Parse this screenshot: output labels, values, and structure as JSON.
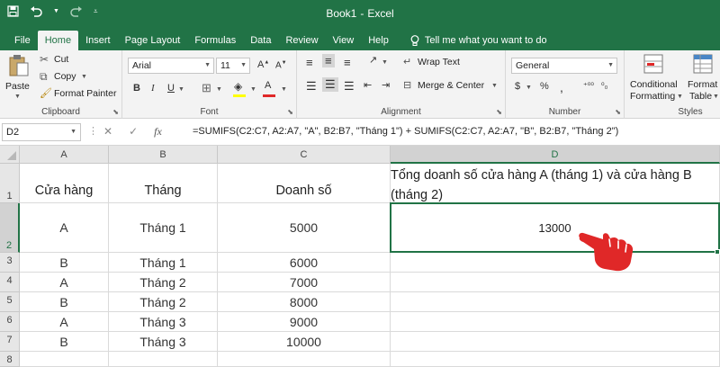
{
  "window": {
    "title": "Book1",
    "separator": "-",
    "app_name": "Excel"
  },
  "tabs": [
    {
      "label": "File",
      "active": false
    },
    {
      "label": "Home",
      "active": true
    },
    {
      "label": "Insert",
      "active": false
    },
    {
      "label": "Page Layout",
      "active": false
    },
    {
      "label": "Formulas",
      "active": false
    },
    {
      "label": "Data",
      "active": false
    },
    {
      "label": "Review",
      "active": false
    },
    {
      "label": "View",
      "active": false
    },
    {
      "label": "Help",
      "active": false
    }
  ],
  "tell_me": "Tell me what you want to do",
  "ribbon": {
    "clipboard": {
      "paste": "Paste",
      "cut": "Cut",
      "copy": "Copy",
      "format_painter": "Format Painter",
      "label": "Clipboard"
    },
    "font": {
      "name": "Arial",
      "size": "11",
      "label": "Font"
    },
    "alignment": {
      "wrap_text": "Wrap Text",
      "merge_center": "Merge & Center",
      "label": "Alignment"
    },
    "number": {
      "format": "General",
      "label": "Number"
    },
    "styles": {
      "conditional": "Conditional",
      "formatting": "Formatting",
      "format_as": "Format a",
      "table": "Table",
      "label": "Styles"
    }
  },
  "formula_bar": {
    "name_box": "D2",
    "formula": "=SUMIFS(C2:C7, A2:A7, \"A\", B2:B7, \"Tháng 1\") + SUMIFS(C2:C7, A2:A7, \"B\", B2:B7, \"Tháng 2\")"
  },
  "sheet": {
    "columns": [
      "A",
      "B",
      "C",
      "D"
    ],
    "rows": [
      "1",
      "2",
      "3",
      "4",
      "5",
      "6",
      "7",
      "8"
    ],
    "header": [
      "Cửa hàng",
      "Tháng",
      "Doanh số"
    ],
    "d1_line1": "Tổng doanh số cửa hàng A (tháng 1) và cửa hàng B",
    "d1_line2": "(tháng 2)",
    "data": [
      [
        "A",
        "Tháng 1",
        "5000",
        "13000"
      ],
      [
        "B",
        "Tháng 1",
        "6000",
        ""
      ],
      [
        "A",
        "Tháng 2",
        "7000",
        ""
      ],
      [
        "B",
        "Tháng 2",
        "8000",
        ""
      ],
      [
        "A",
        "Tháng 3",
        "9000",
        ""
      ],
      [
        "B",
        "Tháng 3",
        "10000",
        ""
      ]
    ],
    "selected_cell": "D2"
  },
  "colors": {
    "accent": "#217346",
    "pointer": "#e02828"
  }
}
